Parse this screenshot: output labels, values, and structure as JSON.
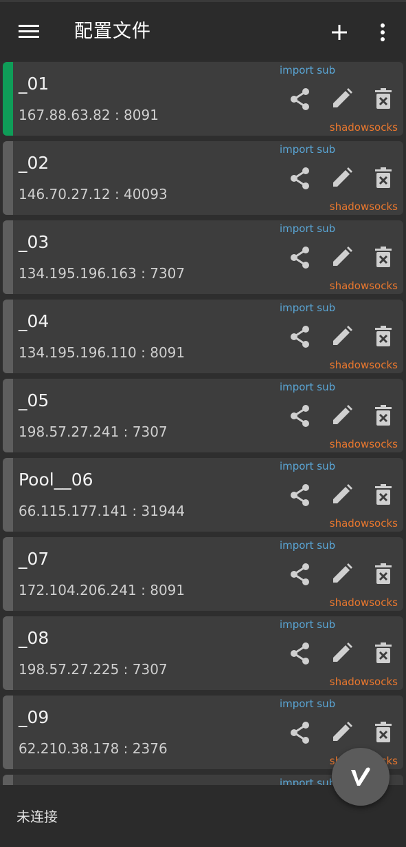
{
  "header": {
    "title": "配置文件",
    "menu_icon": "hamburger-menu-icon",
    "add_icon": "plus-icon",
    "more_icon": "more-vertical-icon"
  },
  "colors": {
    "selected_indicator": "#0f9d58",
    "indicator": "#5e5e5e",
    "subscription_text": "#5aa6d6",
    "protocol_text": "#e8772e"
  },
  "servers": [
    {
      "name": "_01",
      "address": "167.88.63.82 : 8091",
      "subscription": "import sub",
      "protocol": "shadowsocks",
      "selected": true
    },
    {
      "name": "_02",
      "address": "146.70.27.12 : 40093",
      "subscription": "import sub",
      "protocol": "shadowsocks",
      "selected": false
    },
    {
      "name": "_03",
      "address": "134.195.196.163 : 7307",
      "subscription": "import sub",
      "protocol": "shadowsocks",
      "selected": false
    },
    {
      "name": "_04",
      "address": "134.195.196.110 : 8091",
      "subscription": "import sub",
      "protocol": "shadowsocks",
      "selected": false
    },
    {
      "name": "_05",
      "address": "198.57.27.241 : 7307",
      "subscription": "import sub",
      "protocol": "shadowsocks",
      "selected": false
    },
    {
      "name": "Pool__06",
      "address": "66.115.177.141 : 31944",
      "subscription": "import sub",
      "protocol": "shadowsocks",
      "selected": false
    },
    {
      "name": "_07",
      "address": "172.104.206.241 : 8091",
      "subscription": "import sub",
      "protocol": "shadowsocks",
      "selected": false
    },
    {
      "name": "_08",
      "address": "198.57.27.225 : 7307",
      "subscription": "import sub",
      "protocol": "shadowsocks",
      "selected": false
    },
    {
      "name": "_09",
      "address": "62.210.38.178 : 2376",
      "subscription": "import sub",
      "protocol": "shadowsocks",
      "selected": false
    },
    {
      "name": "",
      "address": "",
      "subscription": "import sub",
      "protocol": "",
      "selected": false
    }
  ],
  "card_actions": [
    "share-icon",
    "edit-pencil-icon",
    "delete-trash-icon"
  ],
  "footer": {
    "status": "未连接"
  },
  "fab": {
    "icon": "v-logo-icon"
  }
}
